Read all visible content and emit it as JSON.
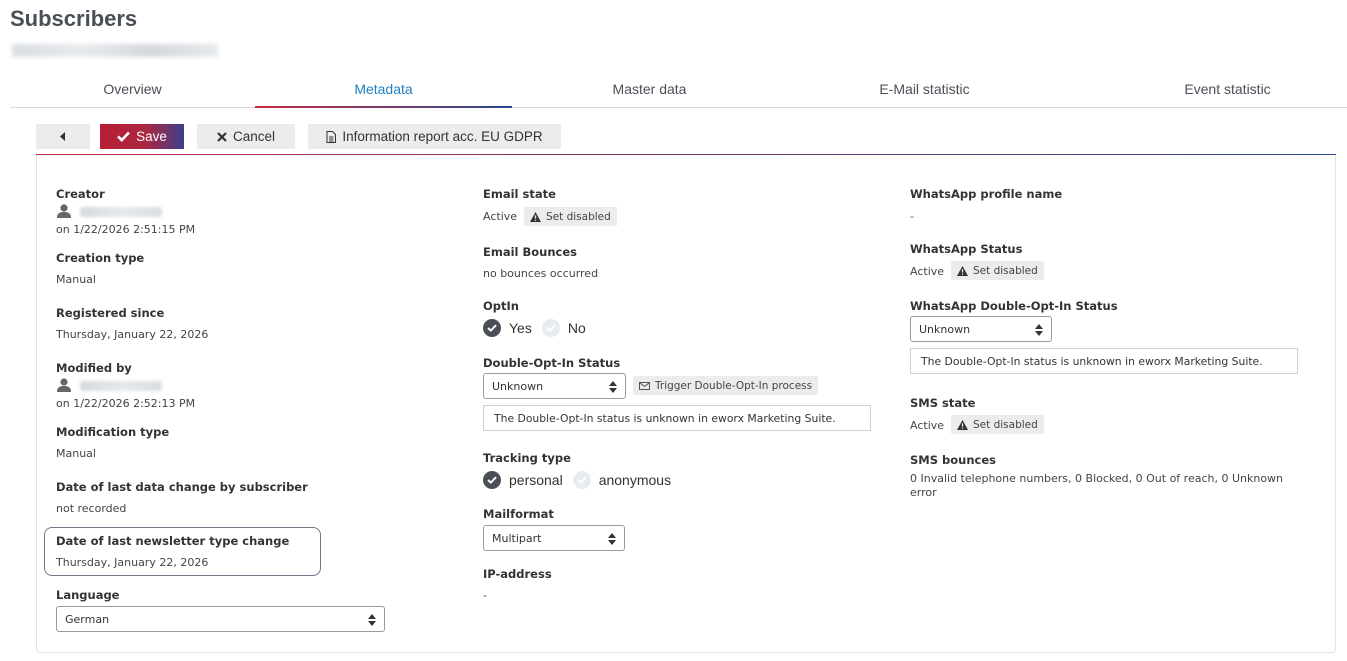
{
  "page": {
    "title": "Subscribers"
  },
  "tabs": [
    {
      "label": "Overview"
    },
    {
      "label": "Metadata"
    },
    {
      "label": "Master data"
    },
    {
      "label": "E-Mail statistic"
    },
    {
      "label": "Event statistic"
    }
  ],
  "toolbar": {
    "save_label": "Save",
    "cancel_label": "Cancel",
    "gdpr_label": "Information report acc. EU GDPR"
  },
  "col1": {
    "creator_label": "Creator",
    "creator_date": "on 1/22/2026 2:51:15 PM",
    "creation_type_label": "Creation type",
    "creation_type_value": "Manual",
    "registered_label": "Registered since",
    "registered_value": "Thursday, January 22, 2026",
    "modified_by_label": "Modified by",
    "modified_date": "on 1/22/2026 2:52:13 PM",
    "modification_type_label": "Modification type",
    "modification_type_value": "Manual",
    "last_data_change_label": "Date of last data change by subscriber",
    "last_data_change_value": "not recorded",
    "newsletter_change_label": "Date of last newsletter type change",
    "newsletter_change_value": "Thursday, January 22, 2026",
    "language_label": "Language",
    "language_value": "German"
  },
  "col2": {
    "email_state_label": "Email state",
    "email_state_value": "Active",
    "set_disabled_label": "Set disabled",
    "bounces_label": "Email Bounces",
    "bounces_value": "no bounces occurred",
    "optin_label": "OptIn",
    "optin_yes": "Yes",
    "optin_no": "No",
    "doi_label": "Double-Opt-In Status",
    "doi_value": "Unknown",
    "trigger_label": "Trigger Double-Opt-In process",
    "doi_info": "The Double-Opt-In status is unknown in eworx Marketing Suite.",
    "tracking_label": "Tracking type",
    "tracking_personal": "personal",
    "tracking_anonymous": "anonymous",
    "mailformat_label": "Mailformat",
    "mailformat_value": "Multipart",
    "ip_label": "IP-address",
    "ip_value": "-"
  },
  "col3": {
    "wa_profile_label": "WhatsApp profile name",
    "wa_profile_value": "-",
    "wa_status_label": "WhatsApp Status",
    "wa_status_value": "Active",
    "set_disabled_label": "Set disabled",
    "wa_doi_label": "WhatsApp Double-Opt-In Status",
    "wa_doi_value": "Unknown",
    "wa_doi_info": "The Double-Opt-In status is unknown in eworx Marketing Suite.",
    "sms_state_label": "SMS state",
    "sms_state_value": "Active",
    "sms_bounces_label": "SMS bounces",
    "sms_bounces_line1": "0 Invalid telephone numbers, 0 Blocked, 0 Out of reach, 0 Unknown",
    "sms_bounces_line2": "error"
  },
  "colors": {
    "accent_blue": "#1f7fc1",
    "brand_red": "#b81e34",
    "brand_navy": "#3c3f8b"
  }
}
